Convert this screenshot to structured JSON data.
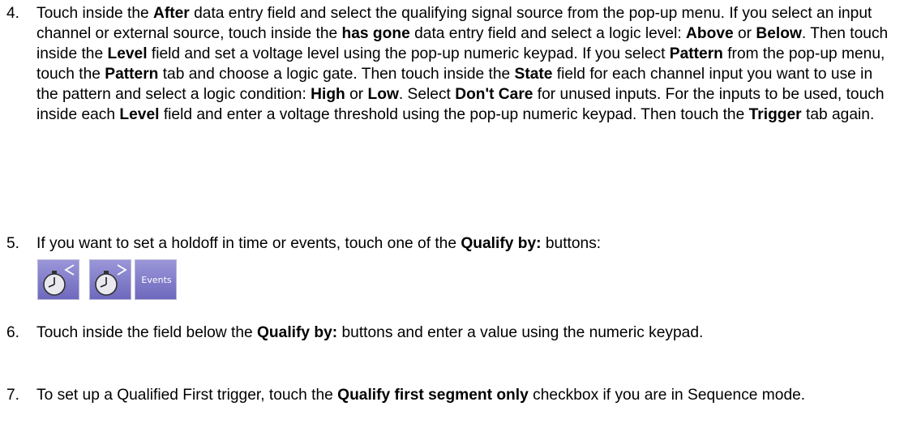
{
  "steps": {
    "s4": {
      "num": "4.",
      "p": [
        "Touch inside the ",
        "After",
        " data entry field and select the qualifying signal source from the pop-up menu. If you select an input channel or external source, touch inside the ",
        "has gone",
        " data entry field and select a logic level: ",
        "Above",
        " or ",
        "Below",
        ". Then touch inside the ",
        "Level",
        " field and set a voltage level using the pop-up numeric keypad. If you select ",
        "Pattern",
        " from the pop-up menu, touch the ",
        "Pattern",
        " tab and choose a logic gate. Then touch inside the ",
        "State",
        " field for each channel input you want to use in the pattern and select a logic condition: ",
        "High",
        " or ",
        "Low",
        ". Select ",
        "Don't Care",
        " for unused inputs. For the inputs to be used, touch inside each ",
        "Level",
        " field and enter a voltage threshold using the pop-up numeric keypad. Then touch the ",
        "Trigger",
        " tab again."
      ]
    },
    "s5": {
      "num": "5.",
      "p": [
        "If you want to set a holdoff in time or events, touch one of the ",
        "Qualify by:",
        " buttons:"
      ]
    },
    "s6": {
      "num": "6.",
      "p": [
        "Touch inside the field below the ",
        "Qualify by:",
        " buttons and enter a value using the numeric keypad."
      ]
    },
    "s7": {
      "num": "7.",
      "p": [
        "To set up a Qualified First trigger, touch the ",
        "Qualify first segment only",
        " checkbox if you are in Sequence mode."
      ]
    }
  },
  "buttons": {
    "time_less_icon": "stopwatch-less-than-icon",
    "time_greater_icon": "stopwatch-greater-than-icon",
    "events_label": "Events",
    "button_color": "#7f7ac9"
  }
}
